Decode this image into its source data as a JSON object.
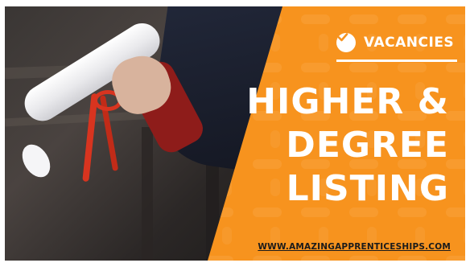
{
  "graphic": {
    "badge_label": "VACANCIES",
    "headline_lines": [
      "HIGHER &",
      "DEGREE",
      "LISTING"
    ],
    "website": "WWW.AMAZINGAPPRENTICESHIPS.COM"
  },
  "colors": {
    "orange": "#F7931E",
    "orange_dark": "#F18A16",
    "text_light": "#FFFFFF",
    "text_dark": "#1B1B1B",
    "ribbon_red": "#D8341F"
  },
  "icons": {
    "badge_icon": "check-circle-icon"
  }
}
